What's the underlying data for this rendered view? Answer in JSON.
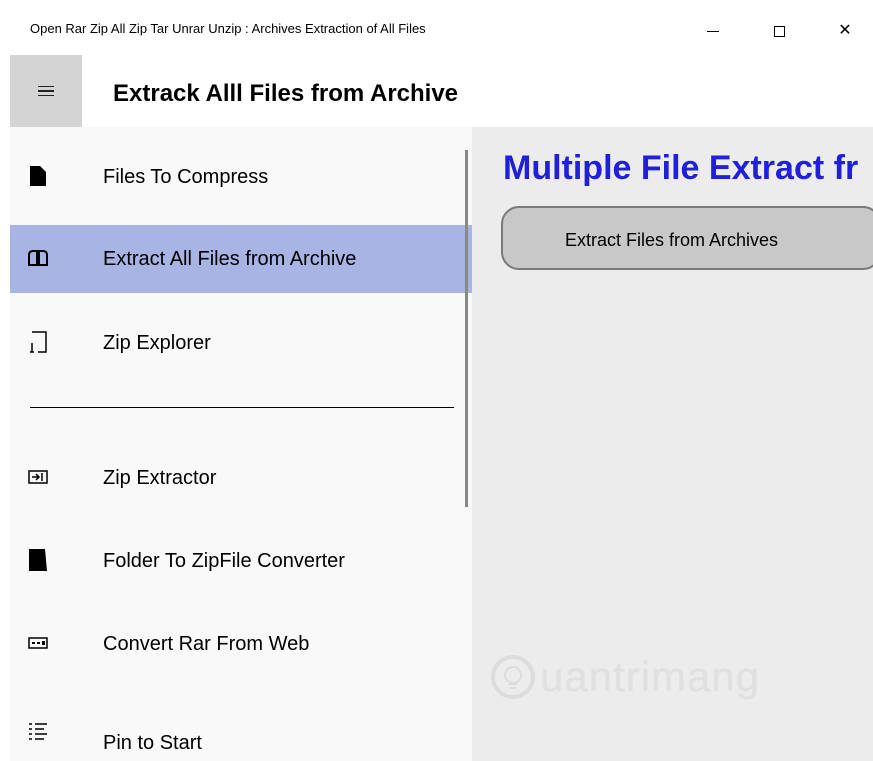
{
  "window": {
    "title": "Open Rar Zip All Zip Tar Unrar Unzip : Archives Extraction of All Files",
    "minimize_icon": "minimize-icon",
    "maximize_icon": "maximize-icon",
    "close_icon": "close-icon",
    "close_glyph": "✕"
  },
  "header": {
    "title": "Extrack Alll Files from  Archive",
    "menu_icon": "hamburger-icon"
  },
  "sidebar": {
    "items": [
      {
        "label": "Files To Compress",
        "icon": "document-icon"
      },
      {
        "label": "Extract All Files from  Archive",
        "icon": "book-open-icon",
        "selected": true
      },
      {
        "label": "Zip Explorer",
        "icon": "tablet-icon"
      },
      {
        "label": "Zip Extractor",
        "icon": "import-arrow-icon"
      },
      {
        "label": "Folder To ZipFile Converter",
        "icon": "folder-icon"
      },
      {
        "label": "Convert Rar From Web",
        "icon": "network-bar-icon"
      },
      {
        "label": "Pin to Start",
        "icon": "list-icon"
      }
    ]
  },
  "main": {
    "heading": "Multiple File Extract fr",
    "extract_button_label": "Extract Files from Archives",
    "watermark": "uantrimang"
  },
  "colors": {
    "selected_bg": "#a8b4e4",
    "heading_color": "#1f1fdc",
    "hamburger_bg": "#d4d4d4",
    "main_bg": "#ececec",
    "button_bg": "#c8c8c8"
  }
}
